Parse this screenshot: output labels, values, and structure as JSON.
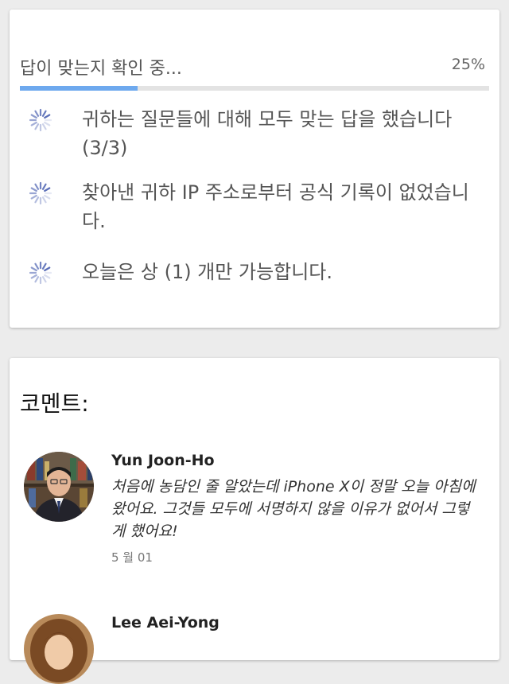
{
  "verification": {
    "title": "답이 맞는지 확인 중...",
    "progress_label": "25%",
    "progress_fraction": 0.25,
    "colors": {
      "progress_fill": "#6ea9ee",
      "progress_track": "#e3e3e3",
      "spinner": "#5b6fb8"
    },
    "items": [
      {
        "icon": "loading-spinner-icon",
        "text": "귀하는 질문들에 대해 모두 맞는 답을 했습니다 (3/3)"
      },
      {
        "icon": "loading-spinner-icon",
        "text": "찾아낸 귀하 IP 주소로부터 공식 기록이 없었습니다."
      },
      {
        "icon": "loading-spinner-icon",
        "text": "오늘은 상 (1) 개만 가능합니다."
      }
    ]
  },
  "comments": {
    "title": "코멘트:",
    "items": [
      {
        "author": "Yun Joon-Ho",
        "body": "처음에 농담인 줄 알았는데 iPhone X이 정말 오늘 아침에 왔어요. 그것들 모두에 서명하지 않을 이유가 없어서 그렇게 했어요!",
        "date": "5 월 01"
      },
      {
        "author": "Lee Aei-Yong",
        "body": "",
        "date": ""
      }
    ]
  }
}
